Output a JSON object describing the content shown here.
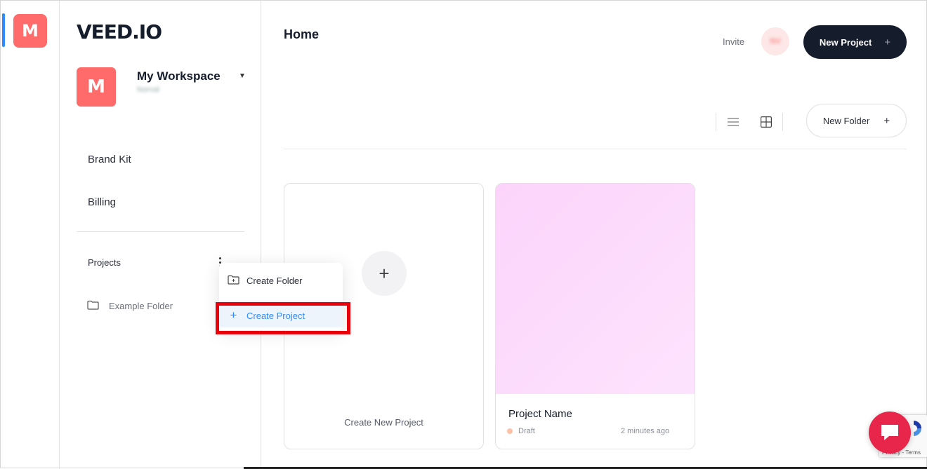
{
  "rail": {
    "workspace_initial": "M"
  },
  "sidebar": {
    "logo": "VEED.IO",
    "workspace": {
      "initial": "M",
      "name": "My Workspace",
      "subtitle": "Norval"
    },
    "nav": [
      "Brand Kit",
      "Billing"
    ],
    "projects_heading": "Projects",
    "folders": [
      "Example Folder"
    ]
  },
  "context_menu": {
    "items": [
      {
        "label": "Create Folder",
        "icon": "folder-plus-icon"
      },
      {
        "label": "Create Project",
        "icon": "plus-icon",
        "highlighted": true
      }
    ]
  },
  "header": {
    "title": "Home",
    "invite_label": "Invite",
    "user_initials": "NV",
    "new_project_label": "New Project"
  },
  "toolbar": {
    "new_folder_label": "New Folder"
  },
  "cards": {
    "create": {
      "label": "Create New Project"
    },
    "project": {
      "name": "Project Name",
      "status": "Draft",
      "updated": "2 minutes ago"
    }
  },
  "recaptcha": {
    "text": "Privacy - Terms"
  },
  "colors": {
    "brand": "#ff6b6b",
    "dark": "#151c2c",
    "accent": "#2f8cff",
    "highlight_box": "#e8000b",
    "chat": "#e8264b"
  }
}
